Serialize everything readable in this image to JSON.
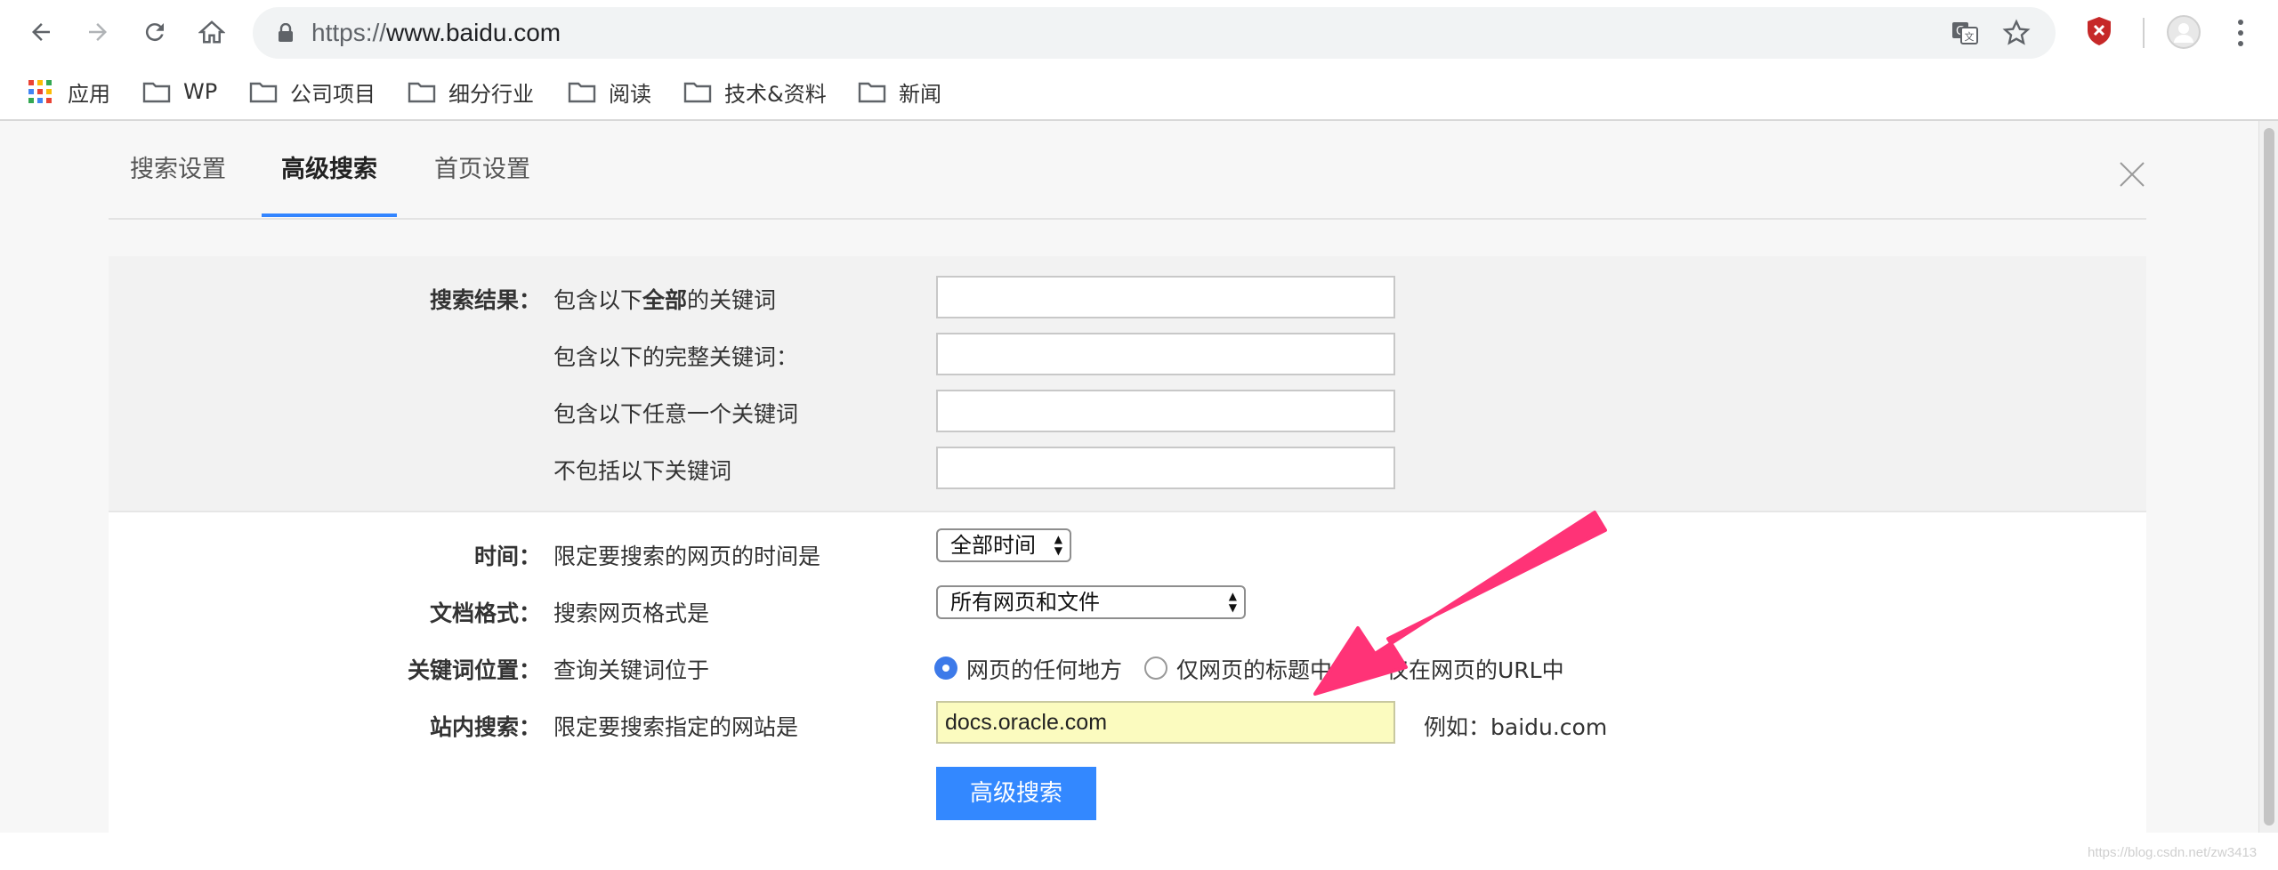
{
  "browser": {
    "url_scheme": "https://",
    "url_host": "www.baidu.com",
    "bookmarks": [
      {
        "label": "应用",
        "kind": "apps"
      },
      {
        "label": "WP",
        "kind": "folder"
      },
      {
        "label": "公司项目",
        "kind": "folder"
      },
      {
        "label": "细分行业",
        "kind": "folder"
      },
      {
        "label": "阅读",
        "kind": "folder"
      },
      {
        "label": "技术&资料",
        "kind": "folder"
      },
      {
        "label": "新闻",
        "kind": "folder"
      }
    ]
  },
  "settings": {
    "tabs": [
      {
        "label": "搜索设置",
        "active": false
      },
      {
        "label": "高级搜索",
        "active": true
      },
      {
        "label": "首页设置",
        "active": false
      }
    ],
    "accent_color": "#3385ff"
  },
  "form": {
    "results_label": "搜索结果：",
    "all_words_prefix": "包含以下",
    "all_words_bold": "全部",
    "all_words_suffix": "的关键词",
    "exact_phrase": "包含以下的完整关键词：",
    "any_words": "包含以下任意一个关键词",
    "exclude_words": "不包括以下关键词",
    "time_label": "时间：",
    "time_desc": "限定要搜索的网页的时间是",
    "time_value": "全部时间",
    "format_label": "文档格式：",
    "format_desc": "搜索网页格式是",
    "format_value": "所有网页和文件",
    "position_label": "关键词位置：",
    "position_desc": "查询关键词位于",
    "position_options": [
      "网页的任何地方",
      "仅网页的标题中",
      "仅在网页的URL中"
    ],
    "site_label": "站内搜索：",
    "site_desc": "限定要搜索指定的网站是",
    "site_value": "docs.oracle.com",
    "site_example": "例如：baidu.com",
    "submit_label": "高级搜索"
  },
  "annotation": {
    "arrow_color": "#ff3377"
  },
  "watermark": "https://blog.csdn.net/zw3413"
}
